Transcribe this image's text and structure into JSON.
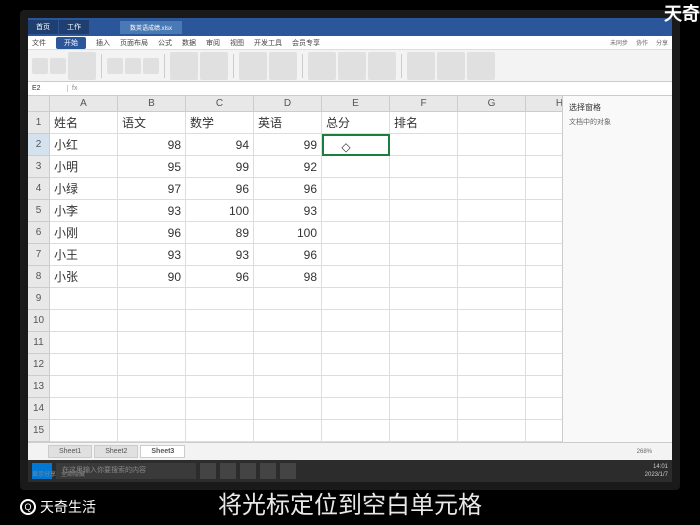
{
  "watermarks": {
    "topRight": "天奇",
    "bottomLeft": "天奇生活"
  },
  "caption": "将光标定位到空白单元格",
  "tabs": {
    "t1": "首页",
    "t2": "工作",
    "file": "数英语成绩.xlsx"
  },
  "menu": {
    "file": "文件",
    "start": "开始",
    "insert": "插入",
    "layout": "页面布局",
    "formula": "公式",
    "data": "数据",
    "review": "审阅",
    "view": "视图",
    "dev": "开发工具",
    "more": "会员专享"
  },
  "ribbonRight": {
    "a": "未同步",
    "b": "协作",
    "c": "分享"
  },
  "nameBox": "E2",
  "sidePanel": {
    "title": "选择窗格",
    "sub": "文档中的对象",
    "footer1": "显示分享",
    "footer2": "全部隐藏"
  },
  "columns": [
    "A",
    "B",
    "C",
    "D",
    "E",
    "F",
    "G",
    "H"
  ],
  "headers": {
    "name": "姓名",
    "chinese": "语文",
    "math": "数学",
    "english": "英语",
    "total": "总分",
    "rank": "排名"
  },
  "chart_data": {
    "type": "table",
    "columns": [
      "姓名",
      "语文",
      "数学",
      "英语",
      "总分",
      "排名"
    ],
    "rows": [
      {
        "name": "小红",
        "chinese": 98,
        "math": 94,
        "english": 99
      },
      {
        "name": "小明",
        "chinese": 95,
        "math": 99,
        "english": 92
      },
      {
        "name": "小绿",
        "chinese": 97,
        "math": 96,
        "english": 96
      },
      {
        "name": "小李",
        "chinese": 93,
        "math": 100,
        "english": 93
      },
      {
        "name": "小刚",
        "chinese": 96,
        "math": 89,
        "english": 100
      },
      {
        "name": "小王",
        "chinese": 93,
        "math": 93,
        "english": 96
      },
      {
        "name": "小张",
        "chinese": 90,
        "math": 96,
        "english": 98
      }
    ]
  },
  "sheets": {
    "s1": "Sheet1",
    "s2": "Sheet2",
    "s3": "Sheet3"
  },
  "taskbar": {
    "search": "在这里输入你要搜索的内容",
    "time": "14:01",
    "date": "2023/1/7"
  },
  "zoom": "268%"
}
